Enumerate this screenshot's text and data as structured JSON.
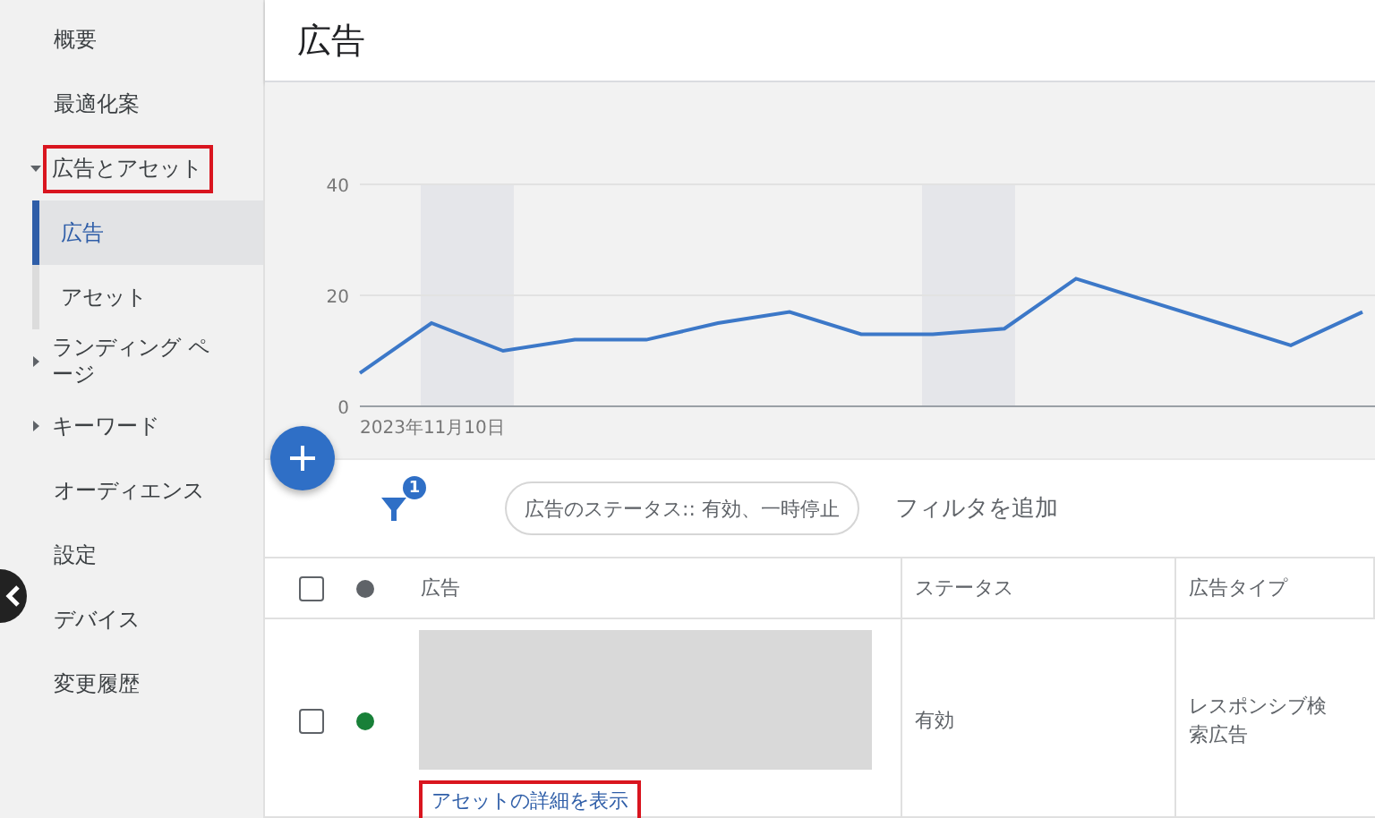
{
  "sidebar": {
    "items": [
      {
        "label": "概要",
        "selected": false,
        "highlighted": false
      },
      {
        "label": "最適化案",
        "selected": false,
        "highlighted": false
      },
      {
        "label": "広告とアセット",
        "selected": false,
        "highlighted": true,
        "expanded": true,
        "children": [
          {
            "label": "広告",
            "selected": true
          },
          {
            "label": "アセット",
            "selected": false
          }
        ]
      },
      {
        "label": "ランディング ページ",
        "selected": false,
        "highlighted": false,
        "expanded": false
      },
      {
        "label": "キーワード",
        "selected": false,
        "highlighted": false,
        "expanded": false
      },
      {
        "label": "オーディエンス",
        "selected": false,
        "highlighted": false
      },
      {
        "label": "設定",
        "selected": false,
        "highlighted": false
      },
      {
        "label": "デバイス",
        "selected": false,
        "highlighted": false
      },
      {
        "label": "変更履歴",
        "selected": false,
        "highlighted": false
      }
    ]
  },
  "page": {
    "title": "広告"
  },
  "chart": {
    "chart_data": {
      "type": "line",
      "ylim": [
        0,
        40
      ],
      "yticks": [
        0,
        20,
        40
      ],
      "series": [
        {
          "color": "#3c78c8",
          "values": [
            6,
            15,
            10,
            12,
            12,
            15,
            17,
            13,
            13,
            14,
            23,
            19,
            15,
            11,
            17
          ]
        }
      ],
      "annotations": [
        {
          "text": "2023年11月10日"
        }
      ]
    }
  },
  "filter_bar": {
    "filter_count": "1",
    "chip": "広告のステータス:: 有効、一時停止",
    "add_filter": "フィルタを追加"
  },
  "table": {
    "header": {
      "checked": false,
      "color": "#5f6368",
      "columns": [
        "広告",
        "ステータス",
        "広告タイプ"
      ]
    },
    "rows": [
      {
        "checked": false,
        "color": "#188038",
        "ad": {
          "link": "アセットの詳細を表示",
          "link_highlighted": true
        },
        "status": "有効",
        "type": "レスポンシブ検索広告"
      }
    ]
  }
}
